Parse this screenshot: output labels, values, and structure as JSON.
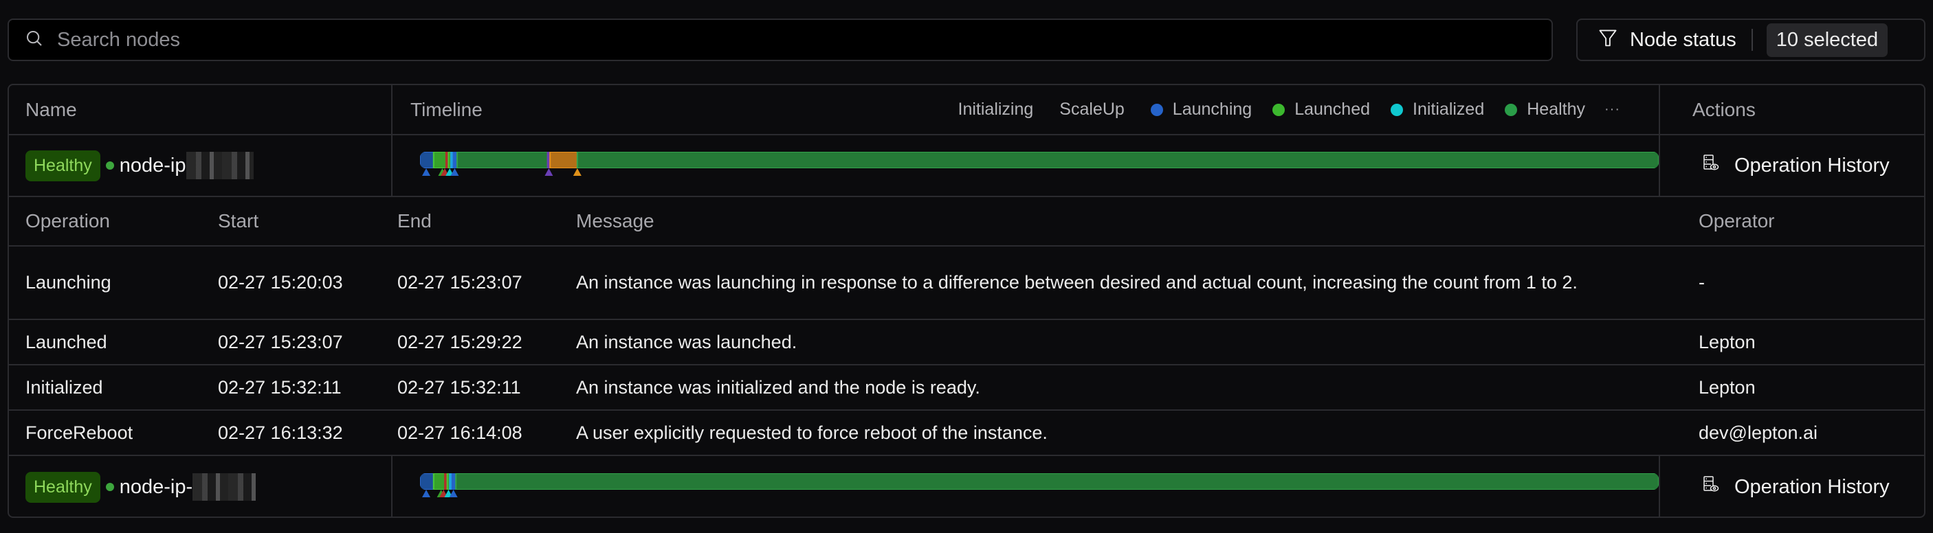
{
  "search": {
    "placeholder": "Search nodes",
    "value": "",
    "icon": "search-icon"
  },
  "filter": {
    "icon": "filter-icon",
    "label": "Node status",
    "count_label": "10 selected"
  },
  "table": {
    "columns": {
      "name": "Name",
      "timeline": "Timeline",
      "actions": "Actions"
    },
    "legend": [
      {
        "label": "Initializing",
        "color": null
      },
      {
        "label": "ScaleUp",
        "color": null
      },
      {
        "label": "Launching",
        "color": "#2563c9"
      },
      {
        "label": "Launched",
        "color": "#3cb82e"
      },
      {
        "label": "Initialized",
        "color": "#10c8cf"
      },
      {
        "label": "Healthy",
        "color": "#2a9d48"
      }
    ],
    "legend_more": "···",
    "nodes": [
      {
        "status": "Healthy",
        "name_prefix": "node-ip",
        "name_redacted": true,
        "action_label": "Operation History",
        "action_icon": "operation-history-icon",
        "timeline": {
          "segments": [
            {
              "state": "Launching",
              "color": "#1c4f99",
              "start": 0.0,
              "end": 0.011
            },
            {
              "state": "Launched",
              "color": "#36a12a",
              "start": 0.011,
              "end": 0.021
            },
            {
              "state": "ForceReboot",
              "color": "#b0302a",
              "start": 0.021,
              "end": 0.023
            },
            {
              "state": "Launched",
              "color": "#36a12a",
              "start": 0.023,
              "end": 0.025
            },
            {
              "state": "Initialized",
              "color": "#20a2e0",
              "start": 0.025,
              "end": 0.027
            },
            {
              "state": "Launching",
              "color": "#2563c9",
              "start": 0.027,
              "end": 0.03
            },
            {
              "state": "Healthy",
              "color": "#257a37",
              "start": 0.03,
              "end": 0.103
            },
            {
              "state": "Initializing",
              "color": "#6a3fb5",
              "start": 0.103,
              "end": 0.105
            },
            {
              "state": "ScaleUp",
              "color": "#b36f18",
              "start": 0.105,
              "end": 0.127
            },
            {
              "state": "Healthy",
              "color": "#257a37",
              "start": 0.127,
              "end": 1.0
            }
          ],
          "markers": [
            {
              "color": "#2563c9",
              "at": 0.005
            },
            {
              "color": "#36a12a",
              "at": 0.018
            },
            {
              "color": "#b0302a",
              "at": 0.02
            },
            {
              "color": "#10c8cf",
              "at": 0.024
            },
            {
              "color": "#2563c9",
              "at": 0.028
            },
            {
              "color": "#6a3fb5",
              "at": 0.104
            },
            {
              "color": "#e0921a",
              "at": 0.127
            }
          ]
        }
      },
      {
        "status": "Healthy",
        "name_prefix": "node-ip-",
        "name_redacted": true,
        "action_label": "Operation History",
        "action_icon": "operation-history-icon",
        "timeline": {
          "segments": [
            {
              "state": "Launching",
              "color": "#1c4f99",
              "start": 0.0,
              "end": 0.011
            },
            {
              "state": "Launched",
              "color": "#36a12a",
              "start": 0.011,
              "end": 0.02
            },
            {
              "state": "ForceReboot",
              "color": "#b0302a",
              "start": 0.02,
              "end": 0.022
            },
            {
              "state": "Launched",
              "color": "#36a12a",
              "start": 0.022,
              "end": 0.024
            },
            {
              "state": "Initialized",
              "color": "#20a2e0",
              "start": 0.024,
              "end": 0.026
            },
            {
              "state": "Launching",
              "color": "#2563c9",
              "start": 0.026,
              "end": 0.029
            },
            {
              "state": "Healthy",
              "color": "#257a37",
              "start": 0.029,
              "end": 1.0
            }
          ],
          "markers": [
            {
              "color": "#2563c9",
              "at": 0.005
            },
            {
              "color": "#36a12a",
              "at": 0.017
            },
            {
              "color": "#b0302a",
              "at": 0.019
            },
            {
              "color": "#10c8cf",
              "at": 0.023
            },
            {
              "color": "#2563c9",
              "at": 0.027
            }
          ]
        }
      }
    ],
    "operations": {
      "columns": {
        "operation": "Operation",
        "start": "Start",
        "end": "End",
        "message": "Message",
        "operator": "Operator"
      },
      "rows": [
        {
          "operation": "Launching",
          "start": "02-27 15:20:03",
          "end": "02-27 15:23:07",
          "message": "An instance was launching in response to a difference between desired and actual count, increasing the count from 1 to 2.",
          "operator": "-"
        },
        {
          "operation": "Launched",
          "start": "02-27 15:23:07",
          "end": "02-27 15:29:22",
          "message": "An instance was launched.",
          "operator": "Lepton"
        },
        {
          "operation": "Initialized",
          "start": "02-27 15:32:11",
          "end": "02-27 15:32:11",
          "message": "An instance was initialized and the node is ready.",
          "operator": "Lepton"
        },
        {
          "operation": "ForceReboot",
          "start": "02-27 16:13:32",
          "end": "02-27 16:14:08",
          "message": "A user explicitly requested to force reboot of the instance.",
          "operator": "dev@lepton.ai"
        }
      ]
    }
  }
}
